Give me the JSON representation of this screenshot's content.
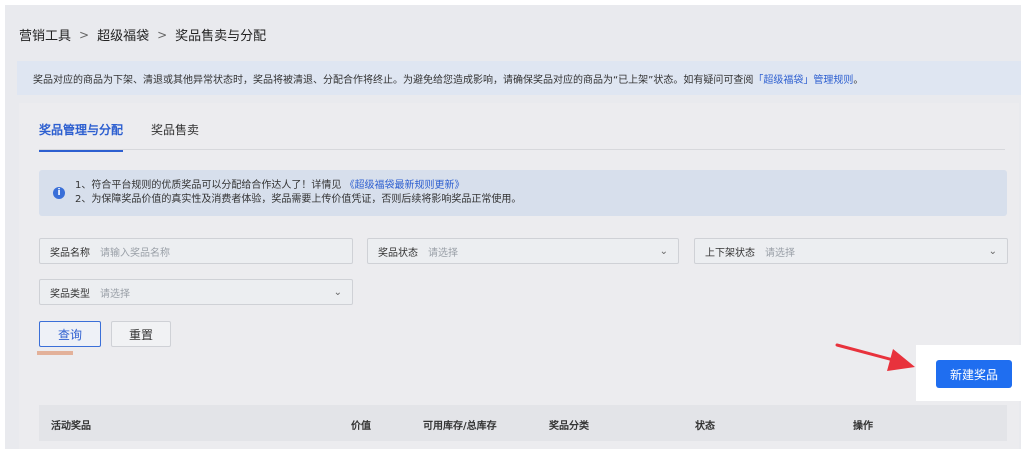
{
  "breadcrumb": {
    "items": [
      "营销工具",
      "超级福袋",
      "奖品售卖与分配"
    ],
    "separator": ">"
  },
  "notice": {
    "text_before": "奖品对应的商品为下架、清退或其他异常状态时，奖品将被清退、分配合作将终止。为避免给您造成影响，请确保奖品对应的商品为“已上架”状态。如有疑问可查阅",
    "link": "「超级福袋」管理规则",
    "text_after": "。"
  },
  "tabs": [
    {
      "label": "奖品管理与分配",
      "active": true
    },
    {
      "label": "奖品售卖",
      "active": false
    }
  ],
  "info": {
    "line1_before": "1、符合平台规则的优质奖品可以分配给合作达人了！详情见",
    "line1_link": "《超级福袋最新规则更新》",
    "line2": "2、为保障奖品价值的真实性及消费者体验，奖品需要上传价值凭证，否则后续将影响奖品正常使用。",
    "icon": "info-icon"
  },
  "filters": {
    "prize_name": {
      "label": "奖品名称",
      "placeholder": "请输入奖品名称"
    },
    "prize_status": {
      "label": "奖品状态",
      "placeholder": "请选择"
    },
    "shelf_status": {
      "label": "上下架状态",
      "placeholder": "请选择"
    },
    "prize_type": {
      "label": "奖品类型",
      "placeholder": "请选择"
    }
  },
  "buttons": {
    "query": "查询",
    "reset": "重置",
    "new_prize": "新建奖品"
  },
  "table": {
    "columns": [
      "活动奖品",
      "价值",
      "可用库存/总库存",
      "奖品分类",
      "状态",
      "操作"
    ]
  },
  "colors": {
    "primary": "#1f6ef0",
    "link": "#2d5fd0",
    "arrow": "#e8323c"
  }
}
